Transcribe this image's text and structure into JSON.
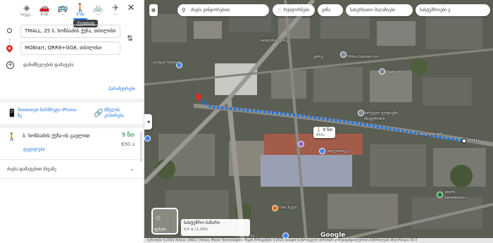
{
  "modes": [
    {
      "icon": "◈",
      "label": "საუკე...",
      "active": false
    },
    {
      "icon": "🚗",
      "label": "9 წთ",
      "active": false
    },
    {
      "icon": "🚌",
      "label": "—",
      "active": false
    },
    {
      "icon": "🚶",
      "label": "9 წთ",
      "active": true
    },
    {
      "icon": "🚲",
      "label": "—",
      "active": false
    },
    {
      "icon": "✈",
      "label": "—",
      "active": false
    }
  ],
  "close_icon": "✕",
  "tooltip": "ქვეითად",
  "origin": "TMALL, 25 ბ. ხოზბაძის ქუჩა, თბილისი",
  "destination": "MOBIart, QRR8+GG8, თბილისი",
  "swap_icon": "⇅",
  "add_destination": "დანიშნულების დამატება",
  "options_link": "პარამეტრები",
  "send_to_phone": "მიითითეთ მარშრუტი iPhone-ზე",
  "copy_link": "ბმულის კოპირება",
  "route": {
    "via": "ბ. ხოზბაძის ქუჩა-ის გავლით",
    "time": "9 წთ",
    "distance": "650 ა",
    "details": "დეტალები"
  },
  "explore": "ძიება დამატებით სხვაზე",
  "map": {
    "search_placeholder": "ძიება ვინდორებით",
    "chips": [
      "რესტორნები",
      "ვიწა",
      "სასურსათო მაღაზიები",
      "სასტუმროები ვ"
    ],
    "walk_time": "9 წთ",
    "walk_dist": "650ა",
    "destination_label": "TMALL",
    "street_label": "ბ. ხოზბაძის ქუჩა",
    "labels": [
      "ცირკე",
      "თბილისის ცირკი",
      "Hilton Garden Inn",
      "ქარგალი",
      "პირველი ელიტაცნი",
      "მხატვრობის",
      "ბიბლიოთეკა",
      "ვაქტიკი სხული",
      "Ooo ხელი",
      "ვიდოს",
      "Genkelmens",
      "Chacha 50"
    ],
    "layers_label": "ფენები",
    "place_name": "სასტუმრო ბაზარი",
    "place_rating": "4.6 ★ (1,280)",
    "google": "Google",
    "attribution": "სურათები ©2025 Airbus, CNES / Airbus, Maxar Technologies, რუკის მონაცემები ©2025 Google  საქართველო  პირობები  კონფიდენციალურობა  მიმოხილვის ინფორმაცია  50 მ"
  },
  "colors": {
    "route": "#1a73e8",
    "pin": "#d93025",
    "accent": "#1a73e8",
    "time": "#188038"
  },
  "icons": {
    "search": "⚲",
    "walk": "🚶",
    "send": "📱",
    "link": "🔗",
    "chevron": "⌄",
    "layers": "◇",
    "collapse": "◂",
    "add": "+",
    "restaurant": "🍴",
    "grid": "▦"
  }
}
